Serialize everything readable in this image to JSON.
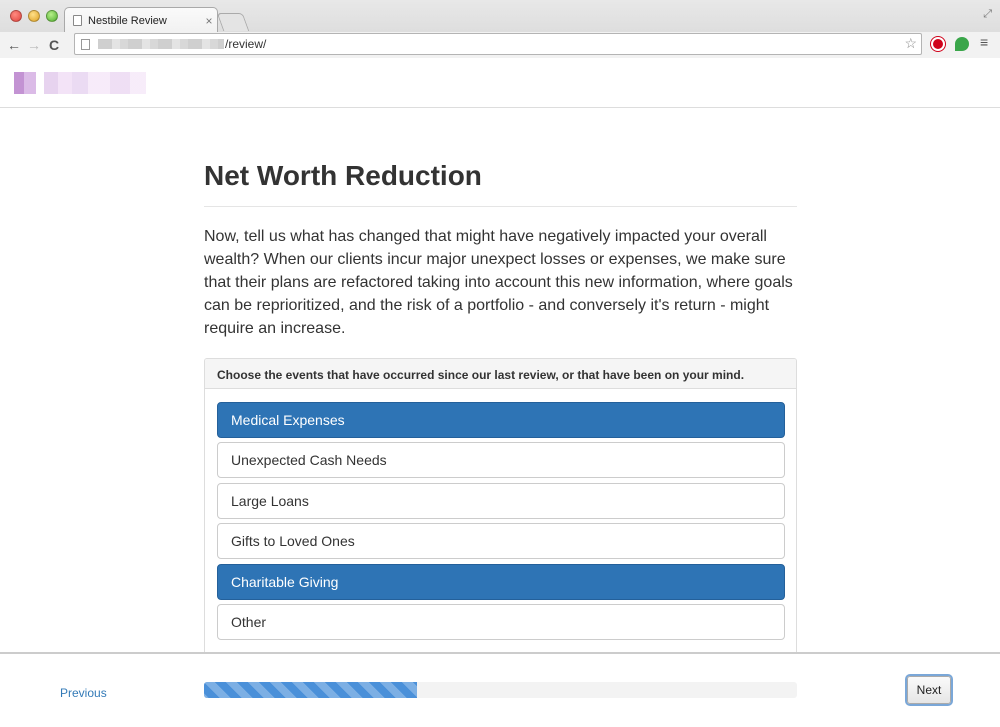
{
  "browser": {
    "tab_title": "Nestbile Review",
    "tab_close": "×",
    "url_path": "/review/",
    "back": "←",
    "forward": "→",
    "reload": "C",
    "star": "☆",
    "menu": "≡",
    "fullscreen": "⤢"
  },
  "page": {
    "title": "Net Worth Reduction",
    "intro": "Now, tell us what has changed that might have negatively impacted your overall wealth? When our clients incur major unexpect losses or expenses, we make sure that their plans are refactored taking into account this new information, where goals can be reprioritized, and the risk of a portfolio - and conversely it's return - might require an increase.",
    "panel_heading": "Choose the events that have occurred since our last review, or that have been on your mind.",
    "options": [
      {
        "label": "Medical Expenses",
        "selected": true
      },
      {
        "label": "Unexpected Cash Needs",
        "selected": false
      },
      {
        "label": "Large Loans",
        "selected": false
      },
      {
        "label": "Gifts to Loved Ones",
        "selected": false
      },
      {
        "label": "Charitable Giving",
        "selected": true
      },
      {
        "label": "Other",
        "selected": false
      }
    ]
  },
  "footer": {
    "previous_label": "Previous",
    "next_label": "Next",
    "progress_fraction": 0.36
  },
  "colors": {
    "selected_option": "#2e74b5",
    "link": "#337ab7",
    "progress": "#4a90d9"
  }
}
